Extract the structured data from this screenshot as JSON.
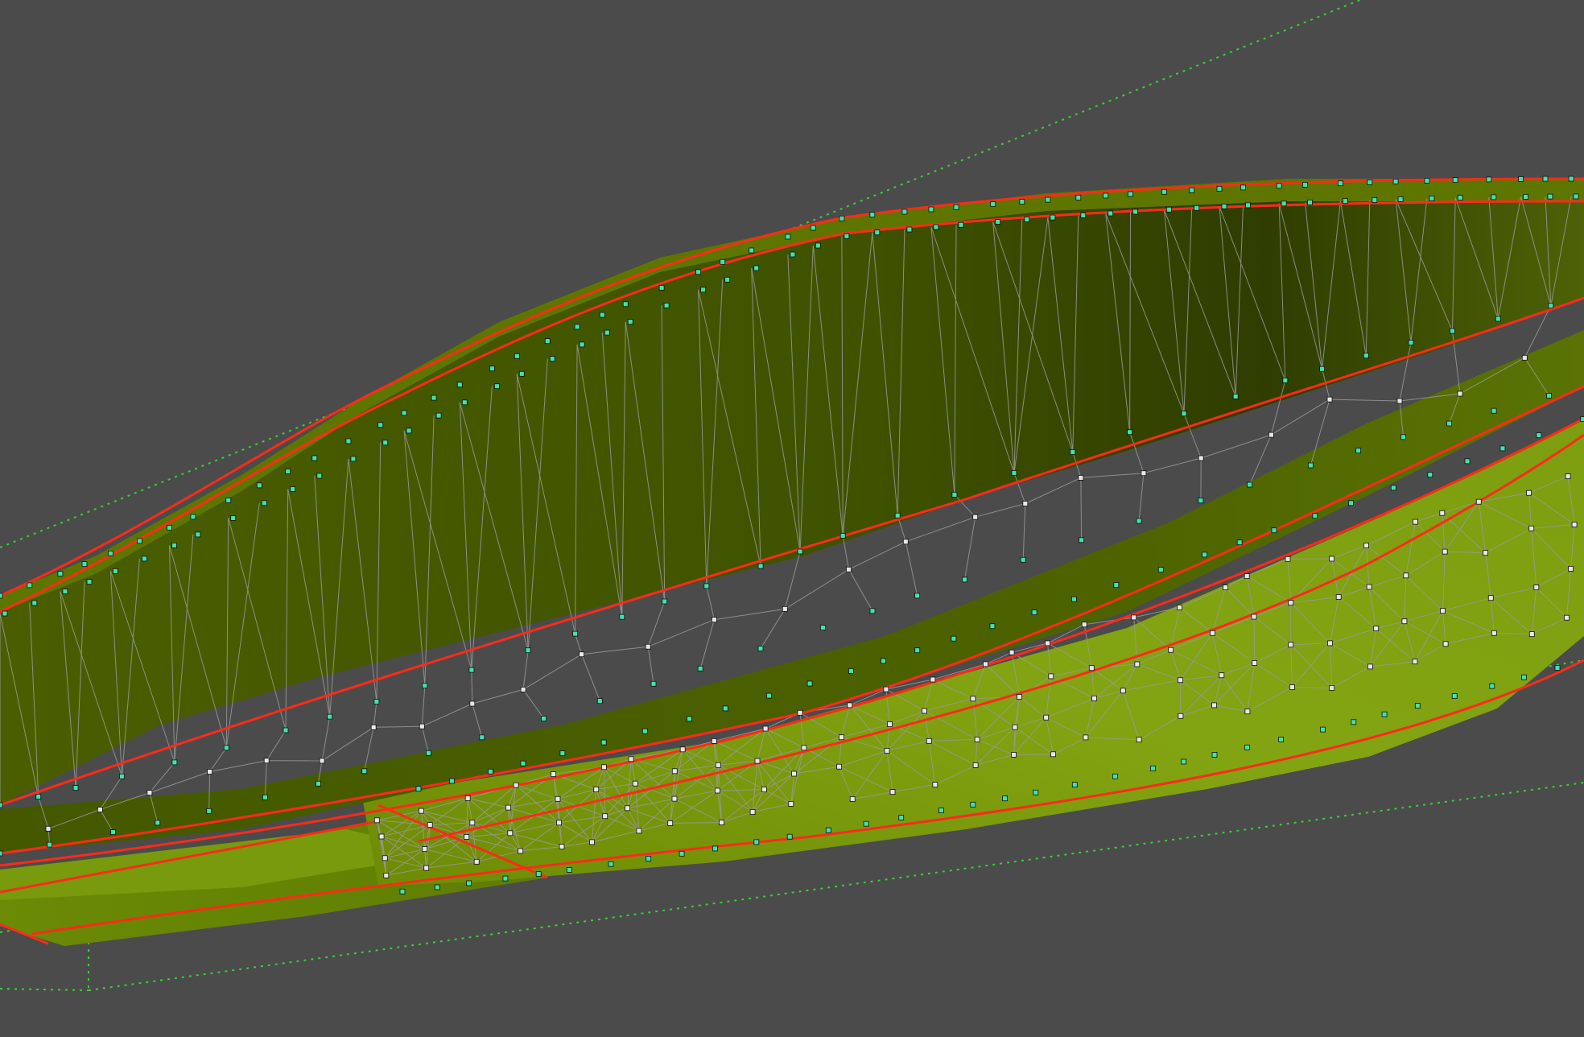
{
  "viewport": {
    "background_color": "#4b4b4b",
    "mode": "mesh-wireframe-over-shaded"
  },
  "mesh": {
    "surface_colors": {
      "hull_wall_dark": "#3a4a00",
      "hull_wall_mid": "#4e6304",
      "inner_wall": "#4a5e02",
      "deck_light": "#7f9f10",
      "deck_mid": "#6d8a08"
    },
    "wire_color": "#9a9a9a",
    "boundary_edge_color": "#ff2a1a",
    "vertex_marker_color": "#e8e8e8",
    "edge_vertex_marker_color": "#3fe3b0",
    "bounding_box_color": "#38d838"
  }
}
